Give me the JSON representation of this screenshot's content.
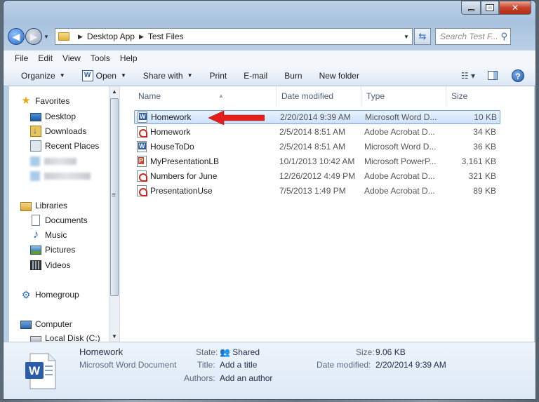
{
  "window": {
    "caption_buttons": {
      "minimize": "minimize",
      "maximize": "maximize",
      "close": "✕"
    }
  },
  "address": {
    "crumbs": [
      "Desktop App",
      "Test Files"
    ],
    "search_placeholder": "Search Test F..."
  },
  "menu": [
    "File",
    "Edit",
    "View",
    "Tools",
    "Help"
  ],
  "toolbar": {
    "organize": "Organize",
    "open": "Open",
    "share_with": "Share with",
    "print": "Print",
    "email": "E-mail",
    "burn": "Burn",
    "new_folder": "New folder"
  },
  "nav": {
    "favorites": "Favorites",
    "desktop": "Desktop",
    "downloads": "Downloads",
    "recent_places": "Recent Places",
    "libraries": "Libraries",
    "documents": "Documents",
    "music": "Music",
    "pictures": "Pictures",
    "videos": "Videos",
    "homegroup": "Homegroup",
    "computer": "Computer",
    "local_disk": "Local Disk (C:)"
  },
  "columns": {
    "name": "Name",
    "date": "Date modified",
    "type": "Type",
    "size": "Size"
  },
  "files": [
    {
      "name": "Homework",
      "date": "2/20/2014 9:39 AM",
      "type": "Microsoft Word D...",
      "size": "10 KB",
      "icon": "word-icon",
      "selected": true
    },
    {
      "name": "Homework",
      "date": "2/5/2014 8:51 AM",
      "type": "Adobe Acrobat D...",
      "size": "34 KB",
      "icon": "pdf-icon"
    },
    {
      "name": "HouseToDo",
      "date": "2/5/2014 8:51 AM",
      "type": "Microsoft Word D...",
      "size": "36 KB",
      "icon": "word-icon"
    },
    {
      "name": "MyPresentationLB",
      "date": "10/1/2013 10:42 AM",
      "type": "Microsoft PowerP...",
      "size": "3,161 KB",
      "icon": "ppt-icon"
    },
    {
      "name": "Numbers for June",
      "date": "12/26/2012 4:49 PM",
      "type": "Adobe Acrobat D...",
      "size": "321 KB",
      "icon": "pdf-icon"
    },
    {
      "name": "PresentationUse",
      "date": "7/5/2013 1:49 PM",
      "type": "Adobe Acrobat D...",
      "size": "89 KB",
      "icon": "pdf-icon"
    }
  ],
  "details": {
    "name": "Homework",
    "kind": "Microsoft Word Document",
    "state_label": "State:",
    "state": "Shared",
    "title_label": "Title:",
    "title": "Add a title",
    "authors_label": "Authors:",
    "authors": "Add an author",
    "size_label": "Size:",
    "size": "9.06 KB",
    "modified_label": "Date modified:",
    "modified": "2/20/2014 9:39 AM"
  },
  "colors": {
    "annotation_arrow": "#e3201b",
    "selection": "#cce2fb"
  }
}
